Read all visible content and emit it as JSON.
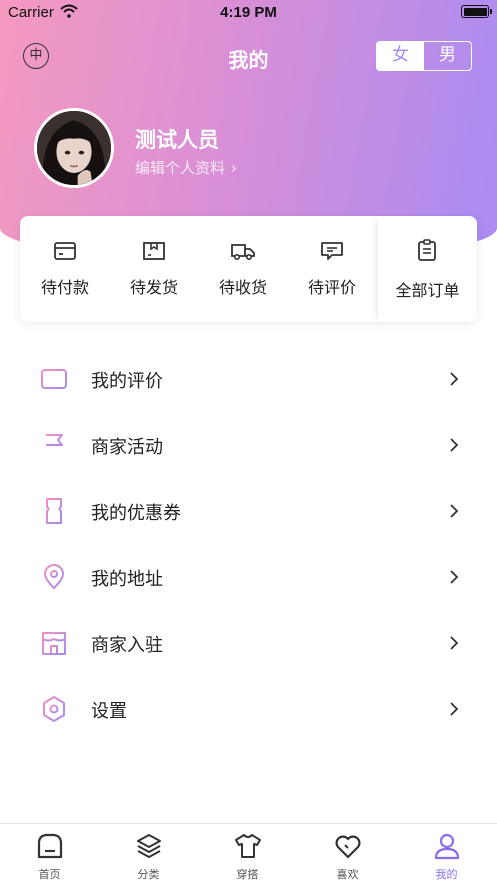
{
  "status_bar": {
    "carrier": "Carrier",
    "time": "4:19 PM"
  },
  "header": {
    "lang_label": "中",
    "title": "我的",
    "gender_options": [
      "女",
      "男"
    ],
    "gender_selected": "女"
  },
  "profile": {
    "name": "测试人员",
    "edit_label": "编辑个人资料",
    "edit_chevron": "›"
  },
  "orders": [
    {
      "label": "待付款",
      "icon": "wallet-icon"
    },
    {
      "label": "待发货",
      "icon": "package-icon"
    },
    {
      "label": "待收货",
      "icon": "truck-icon"
    },
    {
      "label": "待评价",
      "icon": "comment-icon"
    },
    {
      "label": "全部订单",
      "icon": "clipboard-icon"
    }
  ],
  "menu": [
    {
      "label": "我的评价",
      "icon": "review-icon"
    },
    {
      "label": "商家活动",
      "icon": "flag-icon"
    },
    {
      "label": "我的优惠券",
      "icon": "coupon-icon"
    },
    {
      "label": "我的地址",
      "icon": "location-icon"
    },
    {
      "label": "商家入驻",
      "icon": "store-icon"
    },
    {
      "label": "设置",
      "icon": "settings-icon"
    }
  ],
  "tabs": [
    {
      "label": "首页",
      "icon": "home-icon"
    },
    {
      "label": "分类",
      "icon": "layers-icon"
    },
    {
      "label": "穿搭",
      "icon": "shirt-icon"
    },
    {
      "label": "喜欢",
      "icon": "heart-icon"
    },
    {
      "label": "我的",
      "icon": "user-icon"
    }
  ],
  "tab_active": "我的",
  "colors": {
    "gradient_start": "#f59ac0",
    "gradient_end": "#a98cf4",
    "accent": "#8b6cf0",
    "icon_pink": "#f08cc0",
    "icon_purple": "#a78af0"
  }
}
